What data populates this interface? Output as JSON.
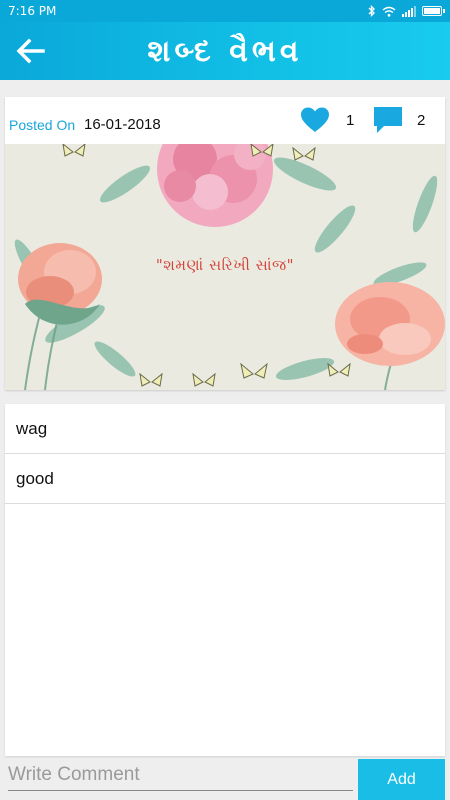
{
  "status_bar": {
    "time": "7:16 PM",
    "battery_level": 0.9
  },
  "app_bar": {
    "title": "શબ્દ વૈભવ",
    "back_icon": "arrow-left-icon"
  },
  "post": {
    "posted_label": "Posted On",
    "posted_date": "16-01-2018",
    "like_count": "1",
    "comment_count": "2",
    "like_icon": "heart-icon",
    "comment_icon": "comment-icon",
    "image_caption": "\"શમણાં સરિખી સાંજ\""
  },
  "comments": [
    {
      "text": "wag"
    },
    {
      "text": "good"
    }
  ],
  "compose": {
    "placeholder": "Write Comment",
    "add_label": "Add"
  },
  "colors": {
    "accent": "#19bde6",
    "posted_label": "#1aa6db",
    "caption": "#d4443a"
  }
}
